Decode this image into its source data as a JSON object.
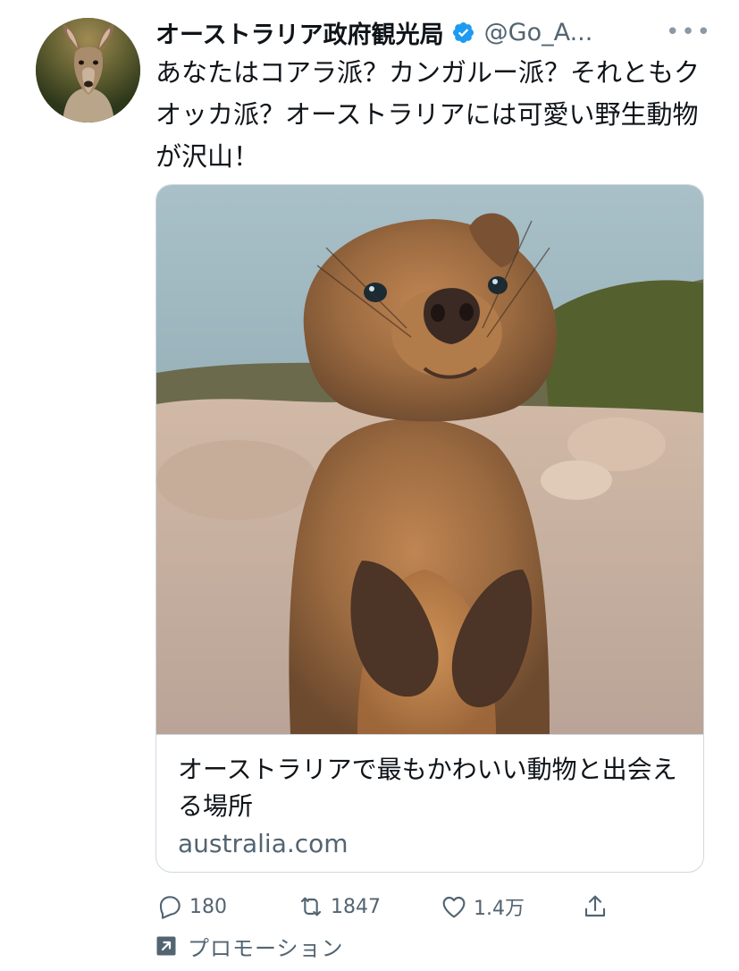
{
  "colors": {
    "text_primary": "#0f1419",
    "text_secondary": "#536471",
    "verified_blue": "#1d9bf0",
    "border": "#cfd9de"
  },
  "tweet": {
    "avatar_icon": "kangaroo-avatar",
    "display_name": "オーストラリア政府観光局",
    "verified_icon": "verified-badge-icon",
    "handle": "@Go_A...",
    "more_icon": "more-horizontal-icon",
    "text": "あなたはコアラ派？カンガルー派？それともクオッカ派？オーストラリアには可愛い野生動物が沢山！"
  },
  "card": {
    "image_subject": "quokka-photo",
    "title": "オーストラリアで最もかわいい動物と出会える場所",
    "domain": "australia.com"
  },
  "actions": {
    "reply": {
      "icon": "reply-icon",
      "count": "180"
    },
    "retweet": {
      "icon": "retweet-icon",
      "count": "1847"
    },
    "like": {
      "icon": "heart-icon",
      "count": "1.4万"
    },
    "share": {
      "icon": "share-icon"
    }
  },
  "promo": {
    "icon": "promoted-arrow-icon",
    "label": "プロモーション"
  }
}
